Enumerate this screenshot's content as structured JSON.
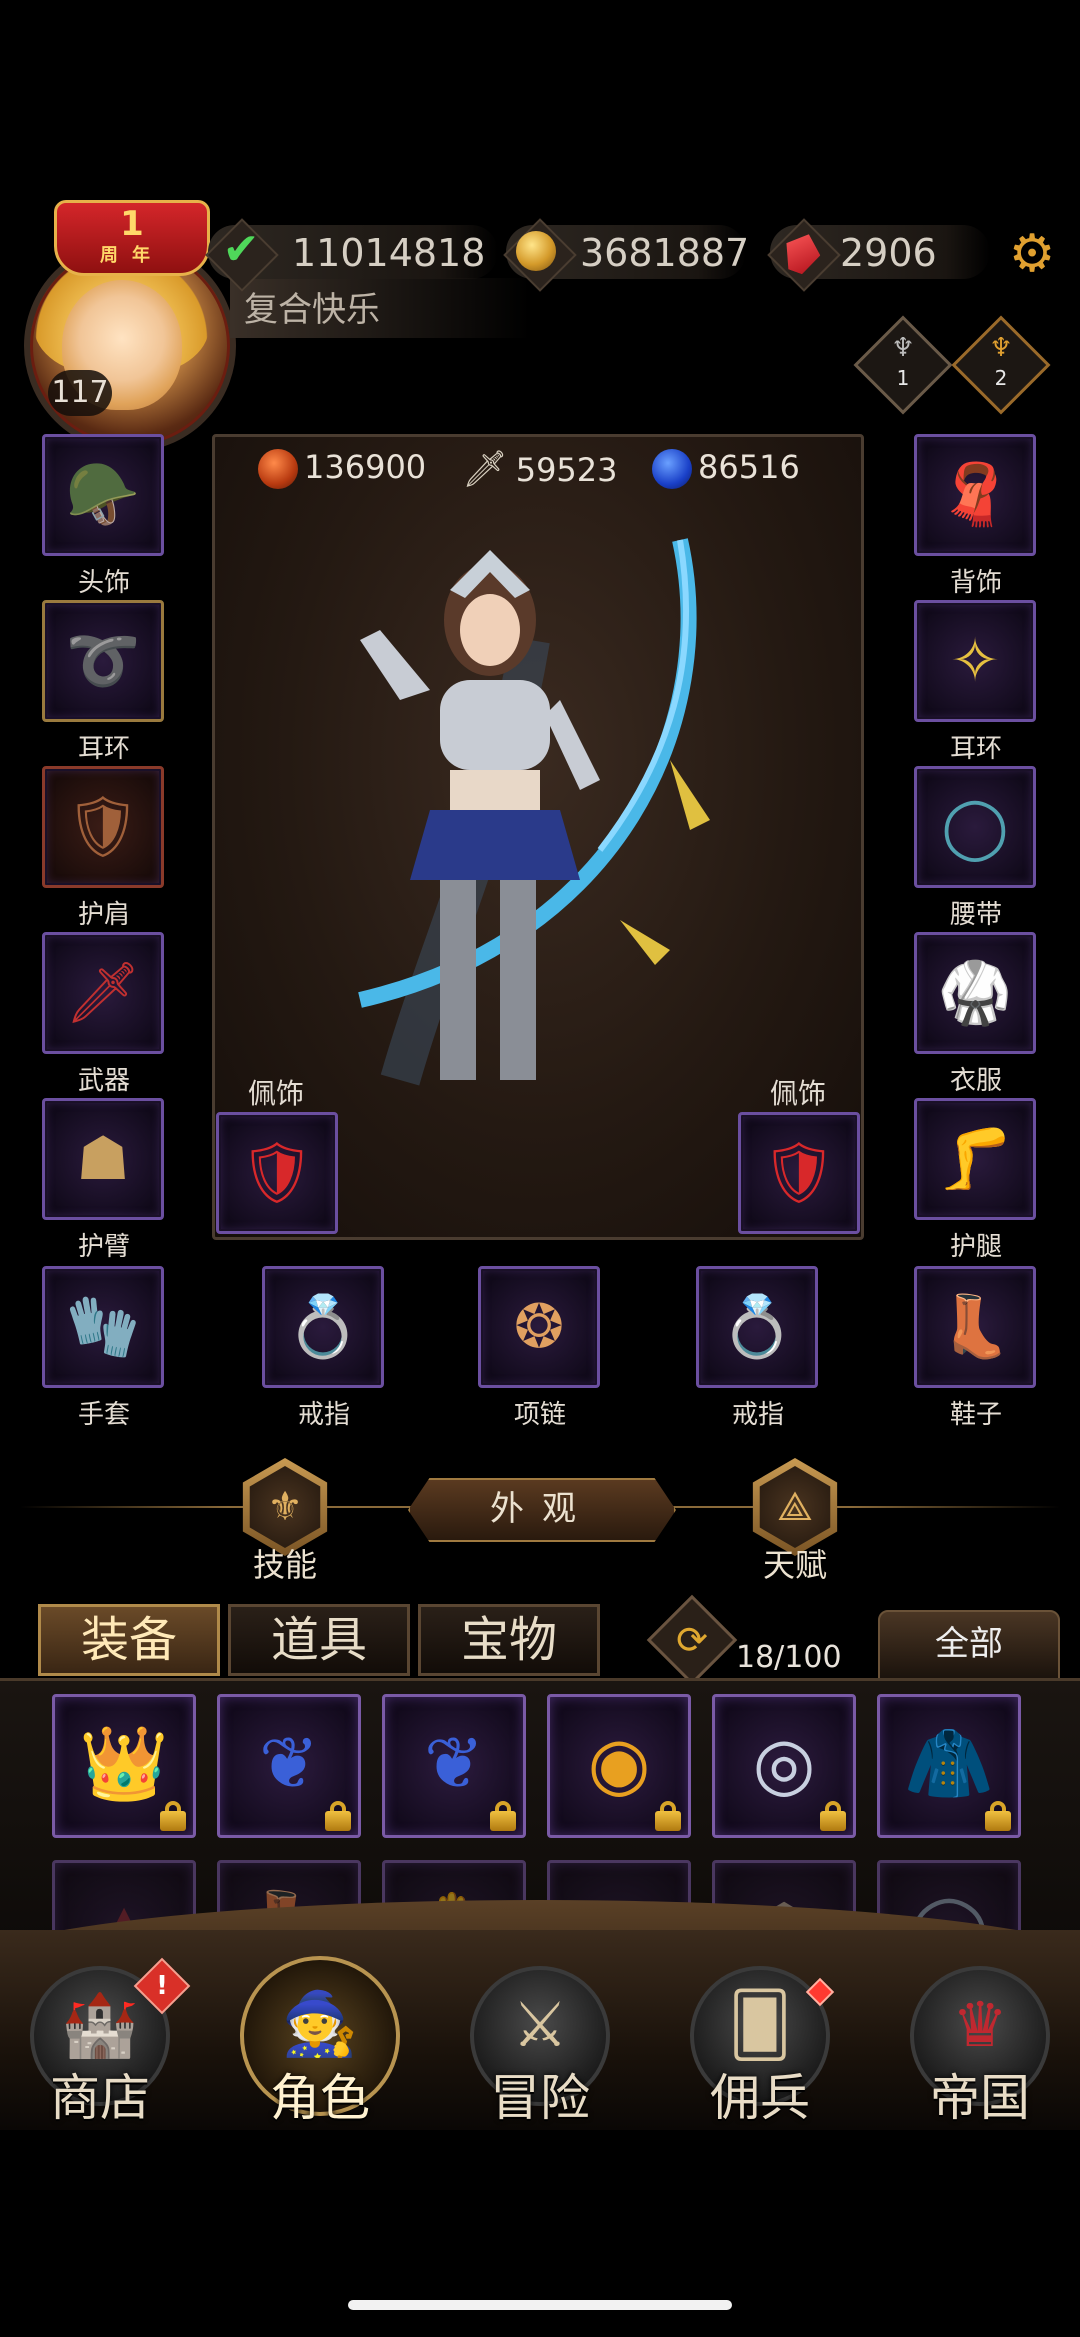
{
  "player": {
    "anniversary_number": "1",
    "anniversary_text": "周年",
    "level": "117",
    "name": "复合快乐"
  },
  "resources": {
    "stamina": "11014818",
    "gold": "3681887",
    "gems": "2906"
  },
  "ranks": [
    {
      "value": "1"
    },
    {
      "value": "2"
    }
  ],
  "stats": {
    "hp": "136900",
    "attack": "59523",
    "mana": "86516"
  },
  "slots": {
    "left": [
      {
        "label": "头饰",
        "icon": "helmet-icon"
      },
      {
        "label": "耳环",
        "icon": "earring-icon"
      },
      {
        "label": "护肩",
        "icon": "pauldron-icon"
      },
      {
        "label": "武器",
        "icon": "sword-icon"
      },
      {
        "label": "护臂",
        "icon": "bracer-icon"
      }
    ],
    "right": [
      {
        "label": "背饰",
        "icon": "cape-icon"
      },
      {
        "label": "耳环",
        "icon": "earring-icon"
      },
      {
        "label": "腰带",
        "icon": "belt-icon"
      },
      {
        "label": "衣服",
        "icon": "armor-icon"
      },
      {
        "label": "护腿",
        "icon": "greaves-icon"
      }
    ],
    "bottom": [
      {
        "label": "手套",
        "icon": "gauntlet-icon"
      },
      {
        "label": "戒指",
        "icon": "ring-icon"
      },
      {
        "label": "项链",
        "icon": "necklace-icon"
      },
      {
        "label": "戒指",
        "icon": "ring-icon"
      },
      {
        "label": "鞋子",
        "icon": "boots-icon"
      }
    ],
    "accessory_left": {
      "label": "佩饰",
      "icon": "amulet-icon"
    },
    "accessory_right": {
      "label": "佩饰",
      "icon": "amulet-icon"
    }
  },
  "mid_nav": {
    "skills": "技能",
    "appearance": "外观",
    "talent": "天赋"
  },
  "inventory": {
    "tabs": [
      "装备",
      "道具",
      "宝物"
    ],
    "count": "18/100",
    "filter": "全部"
  },
  "bottom_nav": [
    {
      "label": "商店",
      "icon": "shop-icon"
    },
    {
      "label": "角色",
      "icon": "character-icon"
    },
    {
      "label": "冒险",
      "icon": "crossed-swords-icon"
    },
    {
      "label": "佣兵",
      "icon": "mercenary-icon"
    },
    {
      "label": "帝国",
      "icon": "crown-icon"
    }
  ],
  "colors": {
    "epic_purple": "#7a5aa6",
    "gold_accent": "#b08a4a",
    "alert_red": "#d93028"
  }
}
